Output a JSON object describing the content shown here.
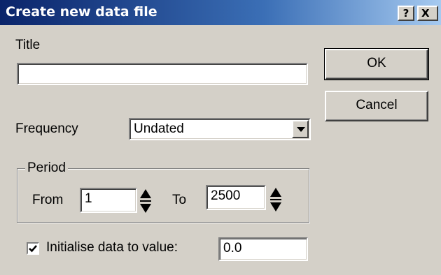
{
  "dialog": {
    "title": "Create new data file",
    "help_label": "?",
    "close_label": "X"
  },
  "title_field": {
    "label": "Title",
    "value": ""
  },
  "buttons": {
    "ok": "OK",
    "cancel": "Cancel"
  },
  "frequency": {
    "label": "Frequency",
    "selected": "Undated"
  },
  "period": {
    "group_label": "Period",
    "from_label": "From",
    "from_value": "1",
    "to_label": "To",
    "to_value": "2500"
  },
  "initialise": {
    "checked": true,
    "label": "Initialise data to value:",
    "value": "0.0"
  },
  "icons": {
    "help": "question-mark-icon",
    "close": "close-icon",
    "dropdown": "chevron-down-icon",
    "spinner": "up-down-arrows-icon",
    "check": "checkmark-icon"
  },
  "colors": {
    "titlebar_start": "#0a246a",
    "titlebar_end": "#a6caf0",
    "face": "#d4d0c8"
  }
}
